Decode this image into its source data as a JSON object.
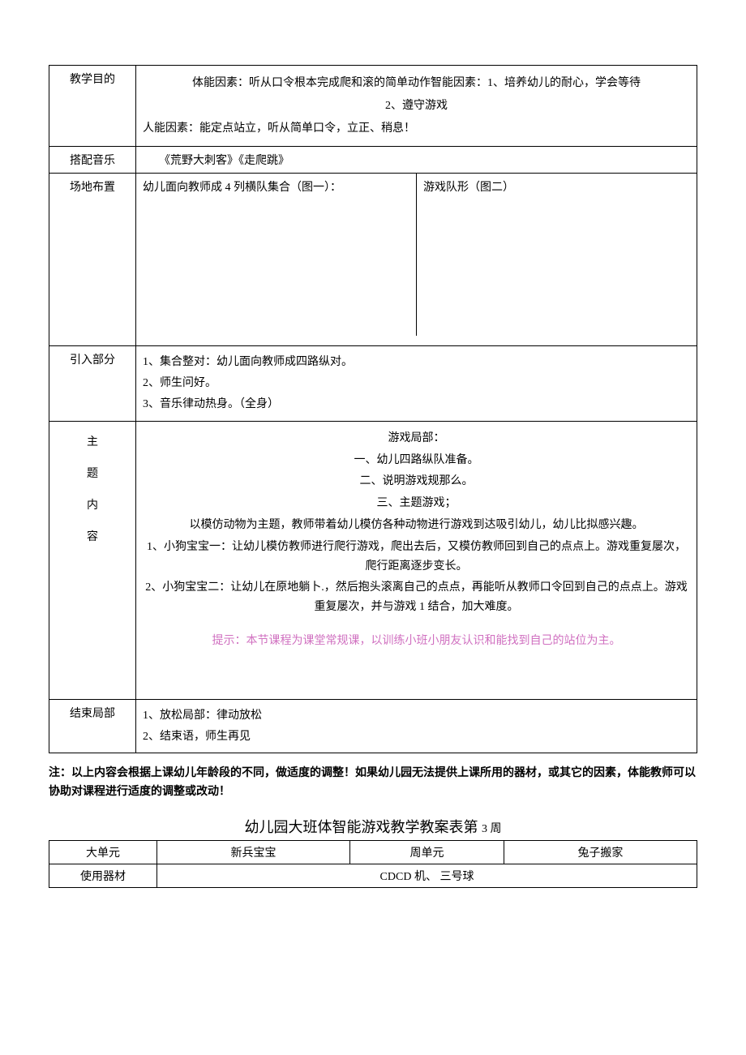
{
  "rows": {
    "goal": {
      "label": "教学目的",
      "line1": "体能因素：听从口令根本完成爬和滚的简单动作智能因素：1、培养幼儿的耐心，学会等待",
      "line2": "2、遵守游戏",
      "line3": "人能因素：能定点站立，听从简单口令，立正、稍息！"
    },
    "music": {
      "label": "搭配音乐",
      "value": "《荒野大刺客》《走爬跳》"
    },
    "field": {
      "label": "场地布置",
      "left": "幼儿面向教师成 4 列横队集合（图一）：",
      "right": "游戏队形（图二）"
    },
    "intro": {
      "label": "引入部分",
      "l1": "1、集合整对：幼儿面向教师成四路纵对。",
      "l2": "2、师生问好。",
      "l3": "3、音乐律动热身。（全身）"
    },
    "theme": {
      "label_main": "主",
      "label_sub1": "题",
      "label_sub2": "内",
      "label_sub3": "容",
      "p1": "游戏局部：",
      "p2": "一、幼儿四路纵队准备。",
      "p3": "二、说明游戏规那么。",
      "p4": "三、主题游戏；",
      "p5": "以模仿动物为主题，教师带着幼儿模仿各种动物进行游戏到达吸引幼儿，幼儿比拟感兴趣。",
      "p6": "1、小狗宝宝一：让幼儿模仿教师进行爬行游戏，爬出去后，又模仿教师回到自己的点点上。游戏重复屡次，爬行距离逐步变长。",
      "p7": "2、小狗宝宝二：让幼儿在原地躺卜.，然后抱头滚离自己的点点，再能听从教师口令回到自己的点点上。游戏重复屡次，并与游戏 1 结合，加大难度。",
      "hint": "提示：本节课程为课堂常规课，以训练小班小朋友认识和能找到自己的站位为主。"
    },
    "end": {
      "label": "结束局部",
      "l1": "1、放松局部：律动放松",
      "l2": "2、结束语，师生再见"
    }
  },
  "note": "注：以上内容会根据上课幼儿年龄段的不同，做适度的调整！如果幼儿园无法提供上课所用的器材，或其它的因素，体能教师可以协助对课程进行适度的调整或改动！",
  "subtitle_main": "幼儿园大班体智能游戏教学教案表第 ",
  "subtitle_week": "3 周",
  "subtable": {
    "r1c1": "大单元",
    "r1c2": "新兵宝宝",
    "r1c3": "周单元",
    "r1c4": "兔子搬家",
    "r2c1": "使用器材",
    "r2c2": "CDCD 机、 三号球"
  }
}
